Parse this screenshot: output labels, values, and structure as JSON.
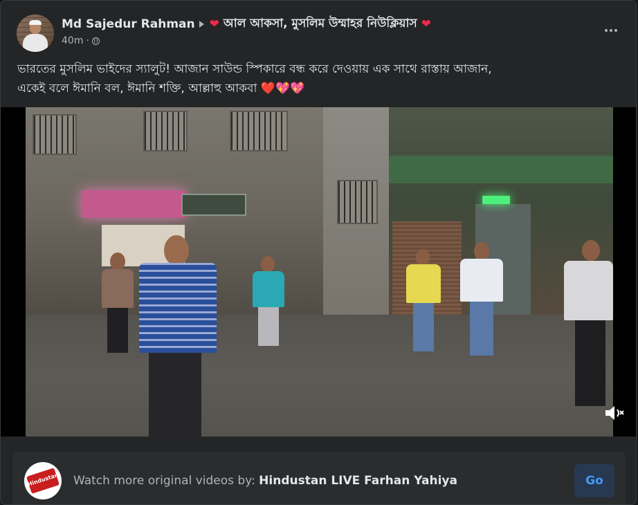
{
  "post": {
    "author": "Md Sajedur Rahman",
    "group": "আল আকসা, মুসলিম উম্মাহর নিউক্লিয়াস",
    "time": "40m",
    "separator": "·",
    "privacy_icon": "globe-icon",
    "more_icon": "more-options-icon",
    "text_line1": "ভারতের মুসলিম ভাইদের স্যালুট! আজান সাউন্ড স্পিকারে বন্ধ করে দেওয়ায় এক সাথে রাস্তায় আজান,",
    "text_line2": "একেই বলে ঈমানি বল, ঈমানি শক্তি, আল্লাহু আকবা",
    "text_emoji": "❤️💖💖",
    "heart_glyph": "❤"
  },
  "video": {
    "mute_icon": "speaker-muted-icon"
  },
  "footer": {
    "logo_text": "Hindustan",
    "watch_prefix": "Watch more original videos by: ",
    "channel_name": "Hindustan LIVE Farhan Yahiya",
    "go_label": "Go"
  },
  "colors": {
    "card_bg": "#242526",
    "page_bg": "#18191a",
    "text_primary": "#e4e6eb",
    "text_secondary": "#b0b3b8",
    "heart": "#f02849",
    "go_button_bg": "#263951",
    "go_button_text": "#4599ff"
  }
}
